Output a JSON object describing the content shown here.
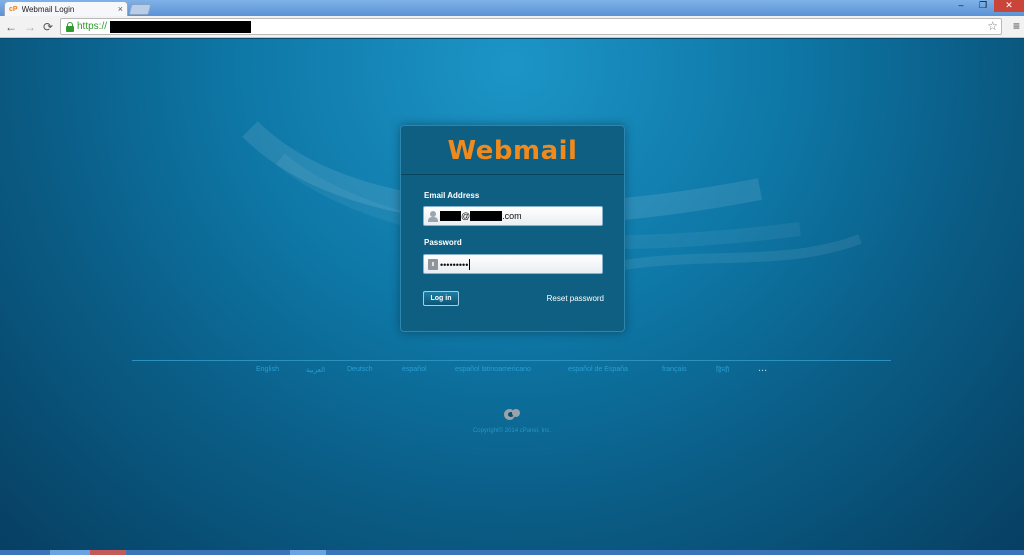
{
  "browser": {
    "tab_title": "Webmail Login",
    "favicon": "cP",
    "tab_close": "×",
    "window_controls": {
      "minimize": "–",
      "maximize": "❐",
      "close": "✕"
    },
    "nav": {
      "back": "←",
      "forward": "→",
      "reload": "⟳"
    },
    "url_scheme": "https://",
    "star": "☆",
    "menu": "≡"
  },
  "login": {
    "logo_text": "Webmail",
    "email_label": "Email Address",
    "email_value_at": "@",
    "email_value_suffix": ".com",
    "password_label": "Password",
    "password_value": "•••••••••",
    "login_button": "Log in",
    "reset_link": "Reset password"
  },
  "languages": [
    "English",
    "العربية",
    "Deutsch",
    "español",
    "español latinoamericano",
    "español de España",
    "français",
    "हिन्दी"
  ],
  "more_languages": "...",
  "footer": {
    "copyright": "Copyright© 2014 cPanel, Inc."
  },
  "colors": {
    "logo": "#f08a1c",
    "background": "#0e77a6",
    "card": "#0f5f82",
    "link": "#2a9ed2",
    "secure": "#2e9b2e"
  },
  "icons": [
    "favicon-icon",
    "close-icon",
    "back-icon",
    "forward-icon",
    "reload-icon",
    "lock-icon",
    "star-icon",
    "menu-icon",
    "user-icon",
    "padlock-icon",
    "cpanel-logo-icon"
  ]
}
